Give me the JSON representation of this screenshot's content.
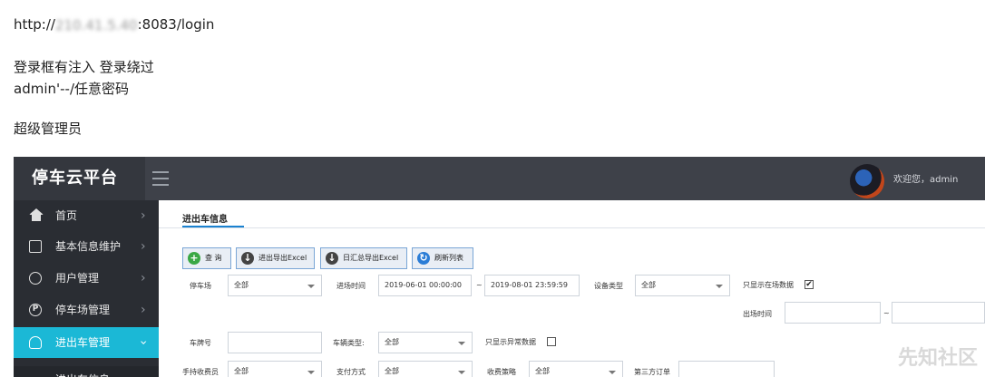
{
  "notes": {
    "url_prefix": "http://",
    "url_blurred": "210.41.5.40",
    "url_suffix": ":8083/login",
    "line1": "登录框有注入 登录绕过",
    "line2": "admin'--/任意密码",
    "line3": "超级管理员"
  },
  "app": {
    "title": "停车云平台",
    "welcome": "欢迎您，admin",
    "sidebar": {
      "items": [
        {
          "label": "首页"
        },
        {
          "label": "基本信息维护"
        },
        {
          "label": "用户管理"
        },
        {
          "label": "停车场管理"
        },
        {
          "label": "进出车管理"
        }
      ],
      "sub_item": "进出车信息"
    },
    "tab": "进出车信息",
    "buttons": {
      "query": "查 询",
      "export_excel": "进出导出Excel",
      "daily_export": "日汇总导出Excel",
      "refresh": "刷新列表"
    },
    "colors": {
      "topbar": "#3e4149",
      "sidebar": "#2a2d33",
      "active": "#1bb8d6",
      "query_icon": "#3aa845",
      "refresh_icon": "#2b7dd6"
    },
    "filters": {
      "parking_lot_label": "停车场",
      "parking_lot_value": "全部",
      "entry_time_label": "进场时间",
      "entry_time_start": "2019-06-01 00:00:00",
      "entry_time_sep": "~",
      "entry_time_end": "2019-08-01 23:59:59",
      "device_type_label": "设备类型",
      "device_type_value": "全部",
      "only_onsite_label": "只显示在场数据",
      "only_onsite_checked": "✔",
      "exit_time_label": "出场时间",
      "exit_time_sep": "~",
      "plate_label": "车牌号",
      "vehicle_type_label": "车辆类型:",
      "vehicle_type_value": "全部",
      "only_abnormal_label": "只显示异常数据",
      "handheld_label": "手持收费员",
      "handheld_value": "全部",
      "payment_label": "支付方式",
      "payment_value": "全部",
      "strategy_label": "收费策略",
      "strategy_value": "全部",
      "third_order_label": "第三方订单"
    }
  },
  "watermark": "先知社区"
}
